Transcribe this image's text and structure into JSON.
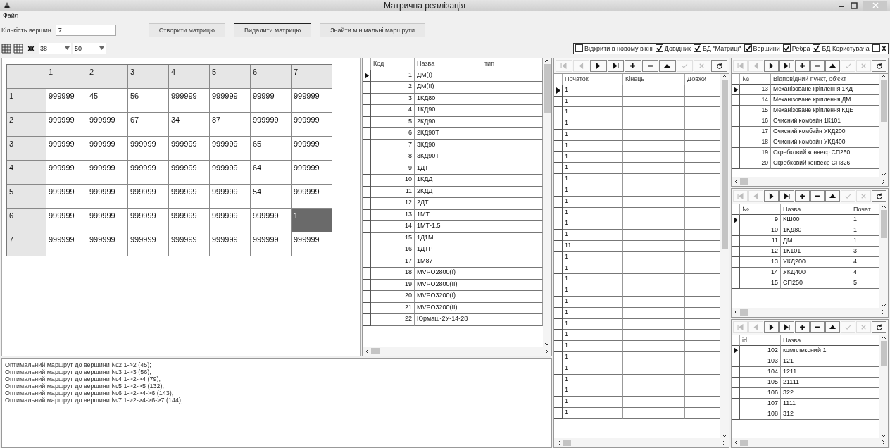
{
  "window": {
    "title": "Матрична реалізація"
  },
  "menu": [
    {
      "label": "Файл"
    }
  ],
  "vertex_count": {
    "label": "Кількість вершин",
    "value": "7"
  },
  "buttons": [
    {
      "label": "Створити матрицю",
      "focused": false
    },
    {
      "label": "Видалити матрицю",
      "focused": true
    },
    {
      "label": "Знайти мінімальні маршрути",
      "focused": false
    }
  ],
  "toolbar": {
    "bold_label": "Ж",
    "width_value": "38",
    "height_value": "50"
  },
  "options": [
    {
      "label": "Відкрити в новому вікні",
      "checked": false
    },
    {
      "label": "Довідник",
      "checked": true
    },
    {
      "label": "БД \"Матриці\"",
      "checked": true
    },
    {
      "label": "Вершини",
      "checked": true
    },
    {
      "label": "Ребра",
      "checked": true
    },
    {
      "label": "БД Користувача",
      "checked": true
    },
    {
      "label": "X",
      "checked": false
    }
  ],
  "matrix": {
    "columns": [
      "1",
      "2",
      "3",
      "4",
      "5",
      "6",
      "7"
    ],
    "rows": [
      {
        "label": "1",
        "cells": [
          {
            "v": "999999",
            "selected": false
          },
          {
            "v": "45",
            "selected": false
          },
          {
            "v": "56",
            "selected": false
          },
          {
            "v": "999999",
            "selected": false
          },
          {
            "v": "999999",
            "selected": false
          },
          {
            "v": "99999",
            "selected": false
          },
          {
            "v": "999999",
            "selected": false
          }
        ]
      },
      {
        "label": "2",
        "cells": [
          {
            "v": "999999",
            "selected": false
          },
          {
            "v": "999999",
            "selected": false
          },
          {
            "v": "67",
            "selected": false
          },
          {
            "v": "34",
            "selected": false
          },
          {
            "v": "87",
            "selected": false
          },
          {
            "v": "999999",
            "selected": false
          },
          {
            "v": "999999",
            "selected": false
          }
        ]
      },
      {
        "label": "3",
        "cells": [
          {
            "v": "999999",
            "selected": false
          },
          {
            "v": "999999",
            "selected": false
          },
          {
            "v": "999999",
            "selected": false
          },
          {
            "v": "999999",
            "selected": false
          },
          {
            "v": "999999",
            "selected": false
          },
          {
            "v": "65",
            "selected": false
          },
          {
            "v": "999999",
            "selected": false
          }
        ]
      },
      {
        "label": "4",
        "cells": [
          {
            "v": "999999",
            "selected": false
          },
          {
            "v": "999999",
            "selected": false
          },
          {
            "v": "999999",
            "selected": false
          },
          {
            "v": "999999",
            "selected": false
          },
          {
            "v": "999999",
            "selected": false
          },
          {
            "v": "64",
            "selected": false
          },
          {
            "v": "999999",
            "selected": false
          }
        ]
      },
      {
        "label": "5",
        "cells": [
          {
            "v": "999999",
            "selected": false
          },
          {
            "v": "999999",
            "selected": false
          },
          {
            "v": "999999",
            "selected": false
          },
          {
            "v": "999999",
            "selected": false
          },
          {
            "v": "999999",
            "selected": false
          },
          {
            "v": "54",
            "selected": false
          },
          {
            "v": "999999",
            "selected": false
          }
        ]
      },
      {
        "label": "6",
        "cells": [
          {
            "v": "999999",
            "selected": false
          },
          {
            "v": "999999",
            "selected": false
          },
          {
            "v": "999999",
            "selected": false
          },
          {
            "v": "999999",
            "selected": false
          },
          {
            "v": "999999",
            "selected": false
          },
          {
            "v": "999999",
            "selected": false
          },
          {
            "v": "1",
            "selected": true
          }
        ]
      },
      {
        "label": "7",
        "cells": [
          {
            "v": "999999",
            "selected": false
          },
          {
            "v": "999999",
            "selected": false
          },
          {
            "v": "999999",
            "selected": false
          },
          {
            "v": "999999",
            "selected": false
          },
          {
            "v": "999999",
            "selected": false
          },
          {
            "v": "999999",
            "selected": false
          },
          {
            "v": "999999",
            "selected": false
          }
        ]
      }
    ]
  },
  "catalog": {
    "columns": [
      "Код",
      "Назва",
      "тип"
    ],
    "rows": [
      {
        "c": [
          "1",
          "ДМ(I)"
        ],
        "selected": true
      },
      {
        "c": [
          "2",
          "ДМ(II)"
        ],
        "selected": false
      },
      {
        "c": [
          "3",
          "1КД80"
        ],
        "selected": false
      },
      {
        "c": [
          "4",
          "1КД90"
        ],
        "selected": false
      },
      {
        "c": [
          "5",
          "2КД90"
        ],
        "selected": false
      },
      {
        "c": [
          "6",
          "2КД90Т"
        ],
        "selected": false
      },
      {
        "c": [
          "7",
          "3КД90"
        ],
        "selected": false
      },
      {
        "c": [
          "8",
          "3КД90Т"
        ],
        "selected": false
      },
      {
        "c": [
          "9",
          "1ДТ"
        ],
        "selected": false
      },
      {
        "c": [
          "10",
          "1КДД"
        ],
        "selected": false
      },
      {
        "c": [
          "11",
          "2КДД"
        ],
        "selected": false
      },
      {
        "c": [
          "12",
          "2ДТ"
        ],
        "selected": false
      },
      {
        "c": [
          "13",
          "1МТ"
        ],
        "selected": false
      },
      {
        "c": [
          "14",
          "1МТ-1.5"
        ],
        "selected": false
      },
      {
        "c": [
          "15",
          "1Д1М"
        ],
        "selected": false
      },
      {
        "c": [
          "16",
          "1ДТР"
        ],
        "selected": false
      },
      {
        "c": [
          "17",
          "1М87"
        ],
        "selected": false
      },
      {
        "c": [
          "18",
          "MVPO2800(I)"
        ],
        "selected": false
      },
      {
        "c": [
          "19",
          "MVPO2800(II)"
        ],
        "selected": false
      },
      {
        "c": [
          "20",
          "MVPO3200(I)"
        ],
        "selected": false
      },
      {
        "c": [
          "21",
          "MVPO3200(II)"
        ],
        "selected": false
      },
      {
        "c": [
          "22",
          "Юрмаш-2У-14-28"
        ],
        "selected": false
      }
    ]
  },
  "edges": {
    "navigator": [
      {
        "kind": "first",
        "disabled": true
      },
      {
        "kind": "prior",
        "disabled": true
      },
      {
        "kind": "next",
        "disabled": false
      },
      {
        "kind": "last",
        "disabled": false
      },
      {
        "kind": "insert",
        "disabled": false
      },
      {
        "kind": "delete",
        "disabled": false
      },
      {
        "kind": "edit",
        "disabled": false
      },
      {
        "kind": "post",
        "disabled": true
      },
      {
        "kind": "cancel",
        "disabled": true
      },
      {
        "kind": "refresh",
        "disabled": false
      }
    ],
    "columns": [
      "Початок",
      "Кінець",
      "Довжи"
    ],
    "rows": [
      {
        "c": [
          "1"
        ],
        "selected": true
      },
      {
        "c": [
          "1"
        ],
        "selected": false
      },
      {
        "c": [
          "1"
        ],
        "selected": false
      },
      {
        "c": [
          "1"
        ],
        "selected": false
      },
      {
        "c": [
          "1"
        ],
        "selected": false
      },
      {
        "c": [
          "1"
        ],
        "selected": false
      },
      {
        "c": [
          "1"
        ],
        "selected": false
      },
      {
        "c": [
          "1"
        ],
        "selected": false
      },
      {
        "c": [
          "1"
        ],
        "selected": false
      },
      {
        "c": [
          "1"
        ],
        "selected": false
      },
      {
        "c": [
          "1"
        ],
        "selected": false
      },
      {
        "c": [
          "1"
        ],
        "selected": false
      },
      {
        "c": [
          "1"
        ],
        "selected": false
      },
      {
        "c": [
          "1"
        ],
        "selected": false
      },
      {
        "c": [
          "11"
        ],
        "selected": false
      },
      {
        "c": [
          "1"
        ],
        "selected": false
      },
      {
        "c": [
          "1"
        ],
        "selected": false
      },
      {
        "c": [
          "1"
        ],
        "selected": false
      },
      {
        "c": [
          "1"
        ],
        "selected": false
      },
      {
        "c": [
          "1"
        ],
        "selected": false
      },
      {
        "c": [
          "1"
        ],
        "selected": false
      },
      {
        "c": [
          "1"
        ],
        "selected": false
      },
      {
        "c": [
          "1"
        ],
        "selected": false
      },
      {
        "c": [
          "1"
        ],
        "selected": false
      },
      {
        "c": [
          "1"
        ],
        "selected": false
      },
      {
        "c": [
          "1"
        ],
        "selected": false
      },
      {
        "c": [
          "1"
        ],
        "selected": false
      },
      {
        "c": [
          "1"
        ],
        "selected": false
      },
      {
        "c": [
          "1"
        ],
        "selected": false
      },
      {
        "c": [
          "1"
        ],
        "selected": false
      }
    ]
  },
  "objects": {
    "navigator": [
      {
        "kind": "first",
        "disabled": true
      },
      {
        "kind": "prior",
        "disabled": true
      },
      {
        "kind": "next",
        "disabled": false
      },
      {
        "kind": "last",
        "disabled": false
      },
      {
        "kind": "insert",
        "disabled": false
      },
      {
        "kind": "delete",
        "disabled": false
      },
      {
        "kind": "edit",
        "disabled": false
      },
      {
        "kind": "post",
        "disabled": true
      },
      {
        "kind": "cancel",
        "disabled": true
      },
      {
        "kind": "refresh",
        "disabled": false
      }
    ],
    "columns": [
      "№",
      "Відповідний пункт, об'єкт"
    ],
    "rows": [
      {
        "c": [
          "13",
          "Механізоване кріплення 1КД"
        ],
        "selected": true
      },
      {
        "c": [
          "14",
          "Механізоване кріплення ДМ"
        ],
        "selected": false
      },
      {
        "c": [
          "15",
          "Механізоване кріплення КДЕ"
        ],
        "selected": false
      },
      {
        "c": [
          "16",
          "Очисний комбайн 1К101"
        ],
        "selected": false
      },
      {
        "c": [
          "17",
          "Очисний комбайн УКД200"
        ],
        "selected": false
      },
      {
        "c": [
          "18",
          "Очисний комбайн УКД400"
        ],
        "selected": false
      },
      {
        "c": [
          "19",
          "Скребковий конвеєр СП250"
        ],
        "selected": false
      },
      {
        "c": [
          "20",
          "Скребковий конвеєр СП326"
        ],
        "selected": false
      }
    ]
  },
  "vertices": {
    "navigator": [
      {
        "kind": "first",
        "disabled": true
      },
      {
        "kind": "prior",
        "disabled": true
      },
      {
        "kind": "next",
        "disabled": false
      },
      {
        "kind": "last",
        "disabled": false
      },
      {
        "kind": "insert",
        "disabled": false
      },
      {
        "kind": "delete",
        "disabled": false
      },
      {
        "kind": "edit",
        "disabled": false
      },
      {
        "kind": "post",
        "disabled": true
      },
      {
        "kind": "cancel",
        "disabled": true
      },
      {
        "kind": "refresh",
        "disabled": false
      }
    ],
    "columns": [
      "№",
      "Назва",
      "Почат"
    ],
    "rows": [
      {
        "c": [
          "9",
          "КШ00",
          "1"
        ],
        "selected": true
      },
      {
        "c": [
          "10",
          "1КД80",
          "1"
        ],
        "selected": false
      },
      {
        "c": [
          "11",
          "ДМ",
          "1"
        ],
        "selected": false
      },
      {
        "c": [
          "12",
          "1К101",
          "3"
        ],
        "selected": false
      },
      {
        "c": [
          "13",
          "УКД200",
          "4"
        ],
        "selected": false
      },
      {
        "c": [
          "14",
          "УКД400",
          "4"
        ],
        "selected": false
      },
      {
        "c": [
          "15",
          "СП250",
          "5"
        ],
        "selected": false
      }
    ]
  },
  "user_db": {
    "navigator": [
      {
        "kind": "first",
        "disabled": true
      },
      {
        "kind": "prior",
        "disabled": true
      },
      {
        "kind": "next",
        "disabled": false
      },
      {
        "kind": "last",
        "disabled": false
      },
      {
        "kind": "insert",
        "disabled": false
      },
      {
        "kind": "delete",
        "disabled": false
      },
      {
        "kind": "edit",
        "disabled": false
      },
      {
        "kind": "post",
        "disabled": true
      },
      {
        "kind": "cancel",
        "disabled": true
      },
      {
        "kind": "refresh",
        "disabled": false
      }
    ],
    "columns": [
      "id",
      "Назва"
    ],
    "rows": [
      {
        "c": [
          "102",
          "комплексний 1"
        ],
        "selected": true
      },
      {
        "c": [
          "103",
          "121"
        ],
        "selected": false
      },
      {
        "c": [
          "104",
          "1211"
        ],
        "selected": false
      },
      {
        "c": [
          "105",
          "21111"
        ],
        "selected": false
      },
      {
        "c": [
          "106",
          "322"
        ],
        "selected": false
      },
      {
        "c": [
          "107",
          "1111"
        ],
        "selected": false
      },
      {
        "c": [
          "108",
          "312"
        ],
        "selected": false
      }
    ]
  },
  "output": {
    "lines": [
      "Оптимальний маршрут до вершини №2  1->2 (45);",
      "Оптимальний маршрут до вершини №3  1->3 (56);",
      "Оптимальний маршрут до вершини №4  1->2->4 (79);",
      "Оптимальний маршрут до вершини №5  1->2->5 (132);",
      "Оптимальний маршрут до вершини №6  1->2->4->6 (143);",
      "Оптимальний маршрут до вершини №7  1->2->4->6->7 (144);"
    ]
  }
}
